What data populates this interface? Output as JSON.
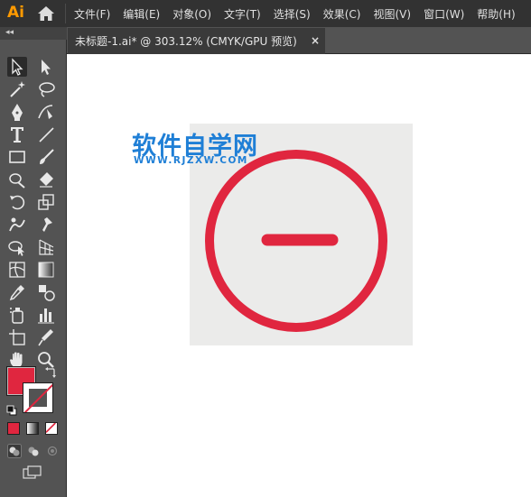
{
  "app": {
    "logo_text": "Ai"
  },
  "menu": {
    "items": [
      {
        "label": "文件(F)"
      },
      {
        "label": "编辑(E)"
      },
      {
        "label": "对象(O)"
      },
      {
        "label": "文字(T)"
      },
      {
        "label": "选择(S)"
      },
      {
        "label": "效果(C)"
      },
      {
        "label": "视图(V)"
      },
      {
        "label": "窗口(W)"
      },
      {
        "label": "帮助(H)"
      }
    ]
  },
  "panel": {
    "collapse_label": "◂◂"
  },
  "tab": {
    "title": "未标题-1.ai* @ 303.12% (CMYK/GPU 预览)",
    "close_label": "×"
  },
  "watermark": {
    "title": "软件自学网",
    "url": "WWW.RJZXW.COM"
  },
  "colors": {
    "fill": "#e0263f",
    "art_red": "#e0263f",
    "artboard_bg": "#ebebea",
    "watermark": "#1f7fd6",
    "menubar": "#323232",
    "panel": "#535353"
  },
  "icons": {
    "home": "home-icon",
    "selection": "selection-tool-icon",
    "direct_selection": "direct-selection-tool-icon",
    "magic_wand": "magic-wand-tool-icon",
    "lasso": "lasso-tool-icon",
    "pen": "pen-tool-icon",
    "curvature": "curvature-tool-icon",
    "type": "type-tool-icon",
    "line": "line-segment-tool-icon",
    "rectangle": "rectangle-tool-icon",
    "paintbrush": "paintbrush-tool-icon",
    "shaper": "shaper-tool-icon",
    "eraser": "eraser-tool-icon",
    "rotate": "rotate-tool-icon",
    "scale": "scale-tool-icon",
    "puppet_warp": "puppet-warp-tool-icon",
    "free_transform": "free-transform-tool-icon",
    "shape_builder": "shape-builder-tool-icon",
    "perspective": "perspective-grid-tool-icon",
    "mesh": "mesh-tool-icon",
    "gradient": "gradient-tool-icon",
    "eyedropper": "eyedropper-tool-icon",
    "blend": "blend-tool-icon",
    "symbol_sprayer": "symbol-sprayer-tool-icon",
    "column_graph": "column-graph-tool-icon",
    "artboard": "artboard-tool-icon",
    "slice": "slice-tool-icon",
    "hand": "hand-tool-icon",
    "zoom": "zoom-tool-icon"
  }
}
